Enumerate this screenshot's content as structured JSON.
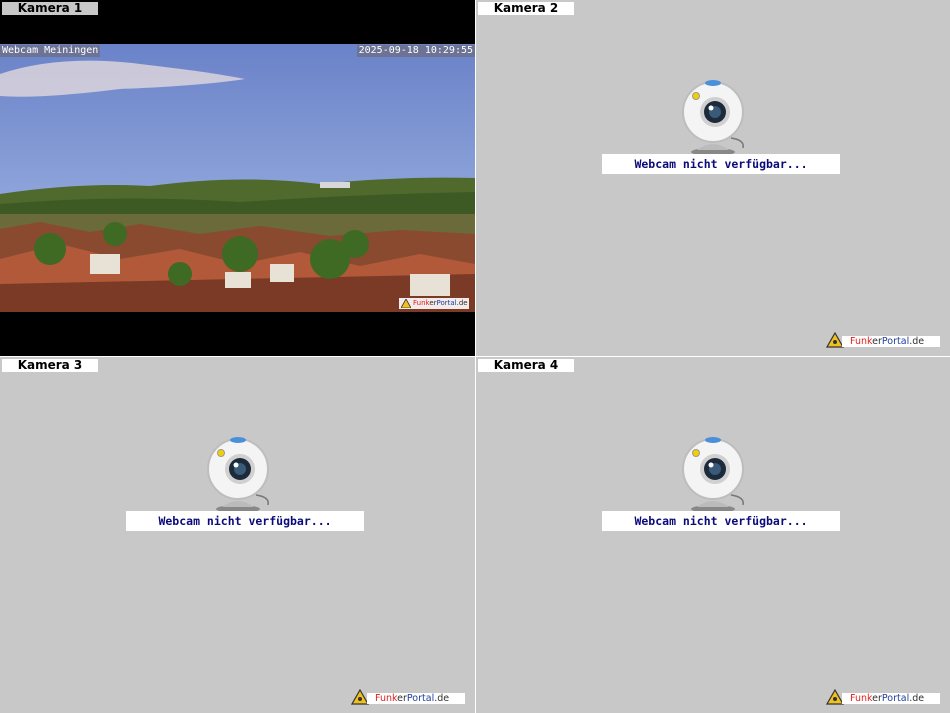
{
  "cameras": [
    {
      "label": "Kamera 1",
      "status": "live",
      "overlay_name": "Webcam Meiningen",
      "overlay_time": "2025-09-18 10:29:55"
    },
    {
      "label": "Kamera 2",
      "status": "offline",
      "message": "Webcam nicht verfügbar..."
    },
    {
      "label": "Kamera 3",
      "status": "offline",
      "message": "Webcam nicht verfügbar..."
    },
    {
      "label": "Kamera 4",
      "status": "offline",
      "message": "Webcam nicht verfügbar..."
    }
  ],
  "watermark": {
    "part1": "Funk",
    "part2": "er",
    "part3": "Portal",
    "part4": ".de"
  },
  "icons": {
    "webcam": "webcam-icon",
    "logo": "funkerportal-logo-icon"
  },
  "colors": {
    "offline_bg": "#c8c8c8",
    "message_text": "#0a0a7a",
    "brand_red": "#e02020",
    "brand_blue": "#2040a0"
  }
}
